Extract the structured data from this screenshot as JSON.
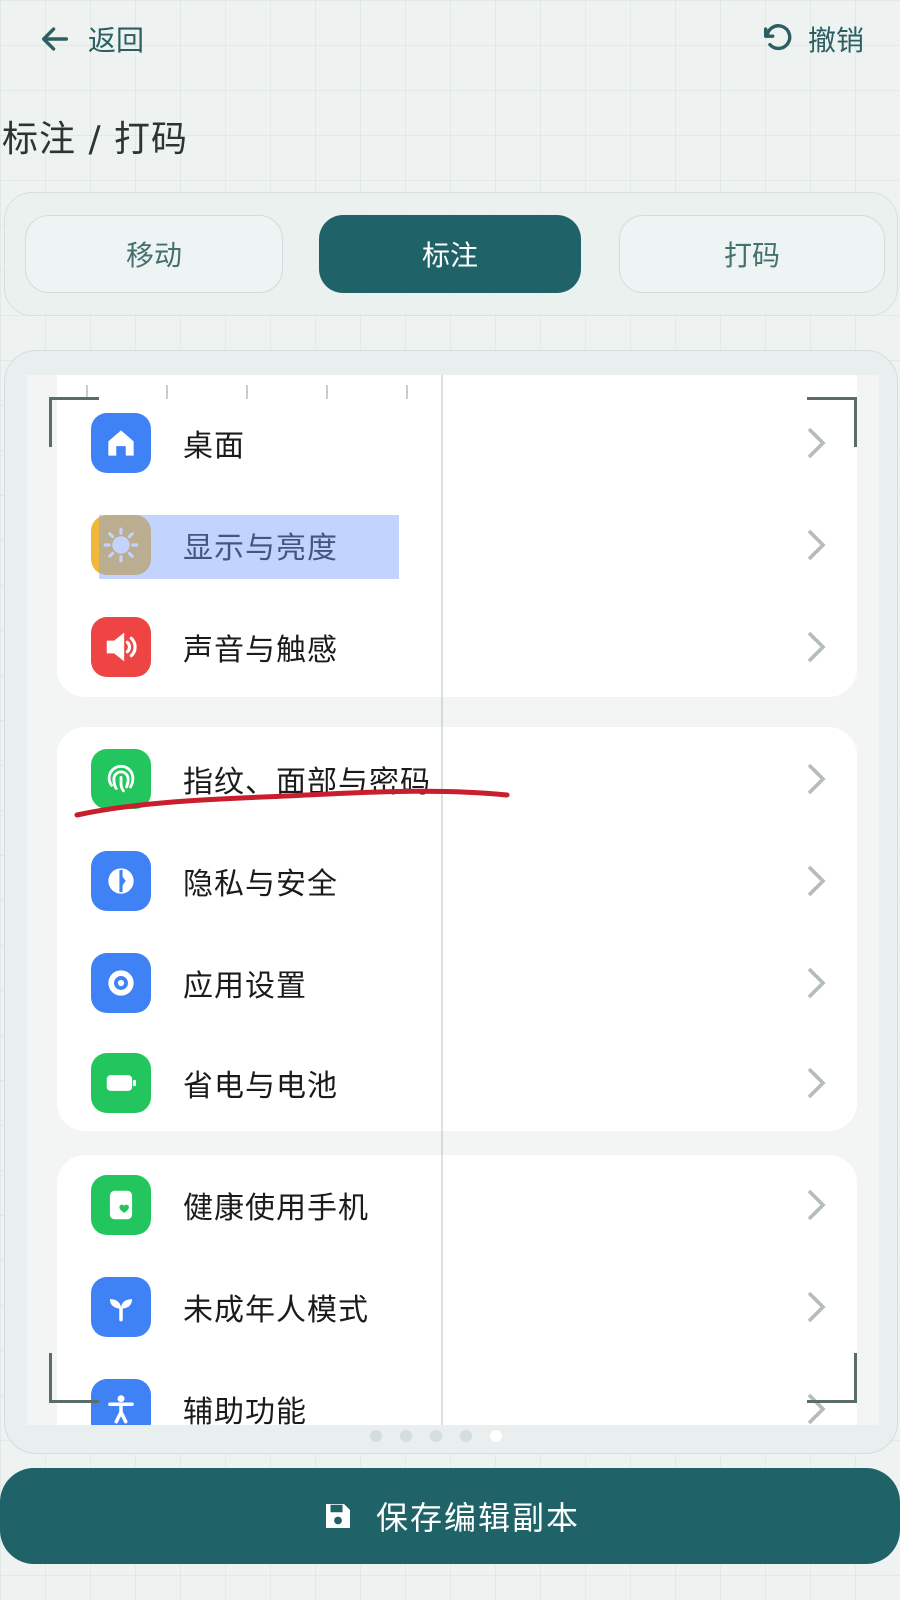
{
  "header": {
    "back_label": "返回",
    "undo_label": "撤销",
    "title": "标注 / 打码"
  },
  "modes": [
    {
      "label": "移动",
      "active": false
    },
    {
      "label": "标注",
      "active": true
    },
    {
      "label": "打码",
      "active": false
    }
  ],
  "settings": {
    "items": [
      {
        "label": "桌面",
        "icon": "home-icon",
        "color": "#3f82f5"
      },
      {
        "label": "显示与亮度",
        "icon": "sun-icon",
        "color": "#f0b83a"
      },
      {
        "label": "声音与触感",
        "icon": "speaker-icon",
        "color": "#ef4444"
      },
      {
        "label": "指纹、面部与密码",
        "icon": "fingerprint-icon",
        "color": "#22c55e"
      },
      {
        "label": "隐私与安全",
        "icon": "privacy-icon",
        "color": "#3f82f5"
      },
      {
        "label": "应用设置",
        "icon": "app-settings-icon",
        "color": "#3f82f5"
      },
      {
        "label": "省电与电池",
        "icon": "battery-icon",
        "color": "#22c55e"
      },
      {
        "label": "健康使用手机",
        "icon": "wellbeing-icon",
        "color": "#22c55e"
      },
      {
        "label": "未成年人模式",
        "icon": "sprout-icon",
        "color": "#3f82f5"
      },
      {
        "label": "辅助功能",
        "icon": "accessibility-icon",
        "color": "#3f82f5"
      }
    ]
  },
  "annotation": {
    "highlight_color": "#78a0fa",
    "underline_color": "#c81e2e"
  },
  "pager": {
    "current_page": 5,
    "page_count": 5
  },
  "footer": {
    "save_label": "保存编辑副本"
  },
  "colors": {
    "accent": "#1f6268"
  }
}
